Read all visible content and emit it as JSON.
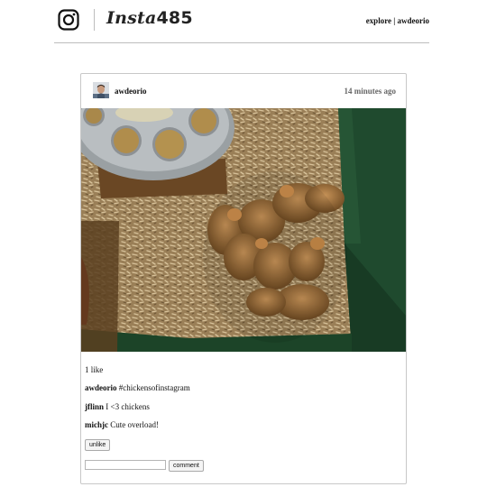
{
  "header": {
    "logo_icon": "instagram-glyph-icon",
    "brand_script": "Insta",
    "brand_number": "485",
    "nav": {
      "explore": "explore",
      "separator": " | ",
      "user": "awdeorio"
    }
  },
  "post": {
    "owner": "awdeorio",
    "timestamp": "14 minutes ago",
    "photo_icon": "chicks-in-brooder-photo",
    "likes": "1 like",
    "comments": [
      {
        "user": "awdeorio",
        "text": " #chickensofinstagram"
      },
      {
        "user": "jflinn",
        "text": " I <3 chickens"
      },
      {
        "user": "michjc",
        "text": " Cute overload!"
      }
    ],
    "unlike_label": "unlike",
    "comment_input_value": "",
    "comment_button_label": "comment"
  },
  "colors": {
    "divider": "#bdbdbd",
    "card_border": "#c8c8c8",
    "timestamp": "#666666"
  }
}
